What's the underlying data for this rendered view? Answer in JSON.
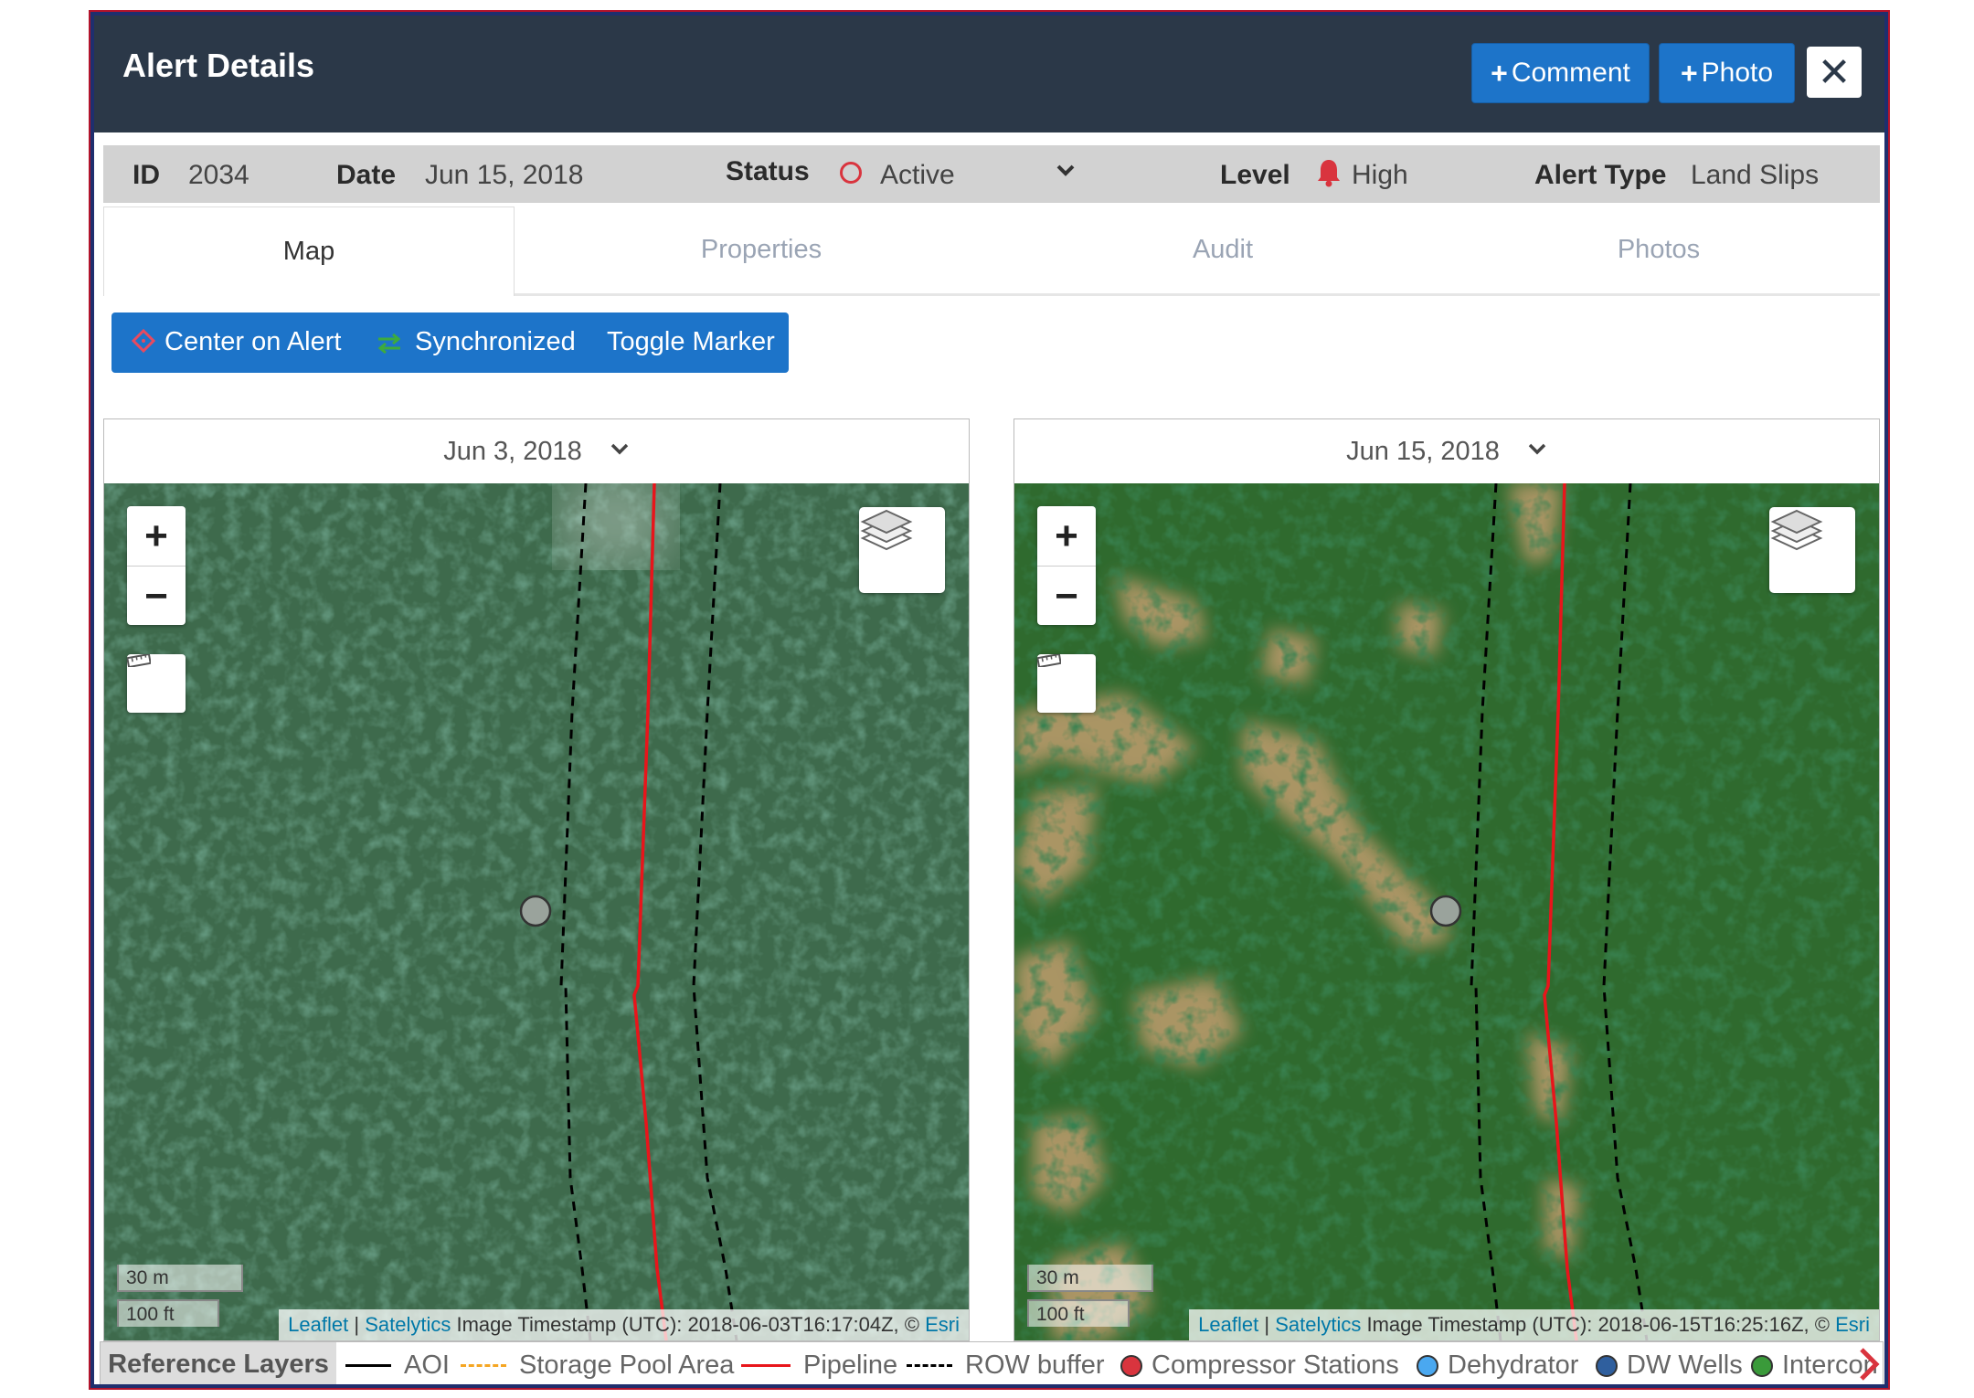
{
  "dialog": {
    "title": "Alert Details",
    "comment_label": "Comment",
    "photo_label": "Photo",
    "close_label": "✕"
  },
  "info": {
    "id_label": "ID",
    "id_value": "2034",
    "date_label": "Date",
    "date_value": "Jun 15, 2018",
    "status_label": "Status",
    "status_value": "Active",
    "level_label": "Level",
    "level_value": "High",
    "type_label": "Alert Type",
    "type_value": "Land Slips"
  },
  "tabs": [
    {
      "label": "Map",
      "active": true
    },
    {
      "label": "Properties",
      "active": false
    },
    {
      "label": "Audit",
      "active": false
    },
    {
      "label": "Photos",
      "active": false
    }
  ],
  "toolbar": {
    "center_label": "Center on Alert",
    "sync_label": "Synchronized",
    "toggle_label": "Toggle Marker"
  },
  "maps": [
    {
      "date": "Jun 3, 2018",
      "scale_m": "30 m",
      "scale_ft": "100 ft",
      "attrib_leaflet": "Leaflet",
      "attrib_sep": " | ",
      "attrib_satelytics": "Satelytics",
      "attrib_text": " Image Timestamp (UTC): 2018-06-03T16:17:04Z, © ",
      "attrib_esri": "Esri"
    },
    {
      "date": "Jun 15, 2018",
      "scale_m": "30 m",
      "scale_ft": "100 ft",
      "attrib_leaflet": "Leaflet",
      "attrib_sep": " | ",
      "attrib_satelytics": "Satelytics",
      "attrib_text": " Image Timestamp (UTC): 2018-06-15T16:25:16Z, © ",
      "attrib_esri": "Esri"
    }
  ],
  "legend": {
    "title": "Reference Layers",
    "items": [
      {
        "label": "AOI",
        "color": "#000000"
      },
      {
        "label": "Storage Pool Area",
        "color": "#f5a623"
      },
      {
        "label": "Pipeline",
        "color": "#e8151b"
      },
      {
        "label": "ROW buffer",
        "color": "#000000"
      },
      {
        "label": "Compressor Stations",
        "color": "#d9343e"
      },
      {
        "label": "Dehydrator",
        "color": "#4aa8f0"
      },
      {
        "label": "DW Wells",
        "color": "#2f5f9e"
      },
      {
        "label": "Intercon",
        "color": "#3a9a3a"
      }
    ]
  },
  "colors": {
    "header_bg": "#2b3848",
    "button_blue": "#1d74c9",
    "status_red": "#d9343e",
    "pipeline_red": "#e8151b"
  }
}
